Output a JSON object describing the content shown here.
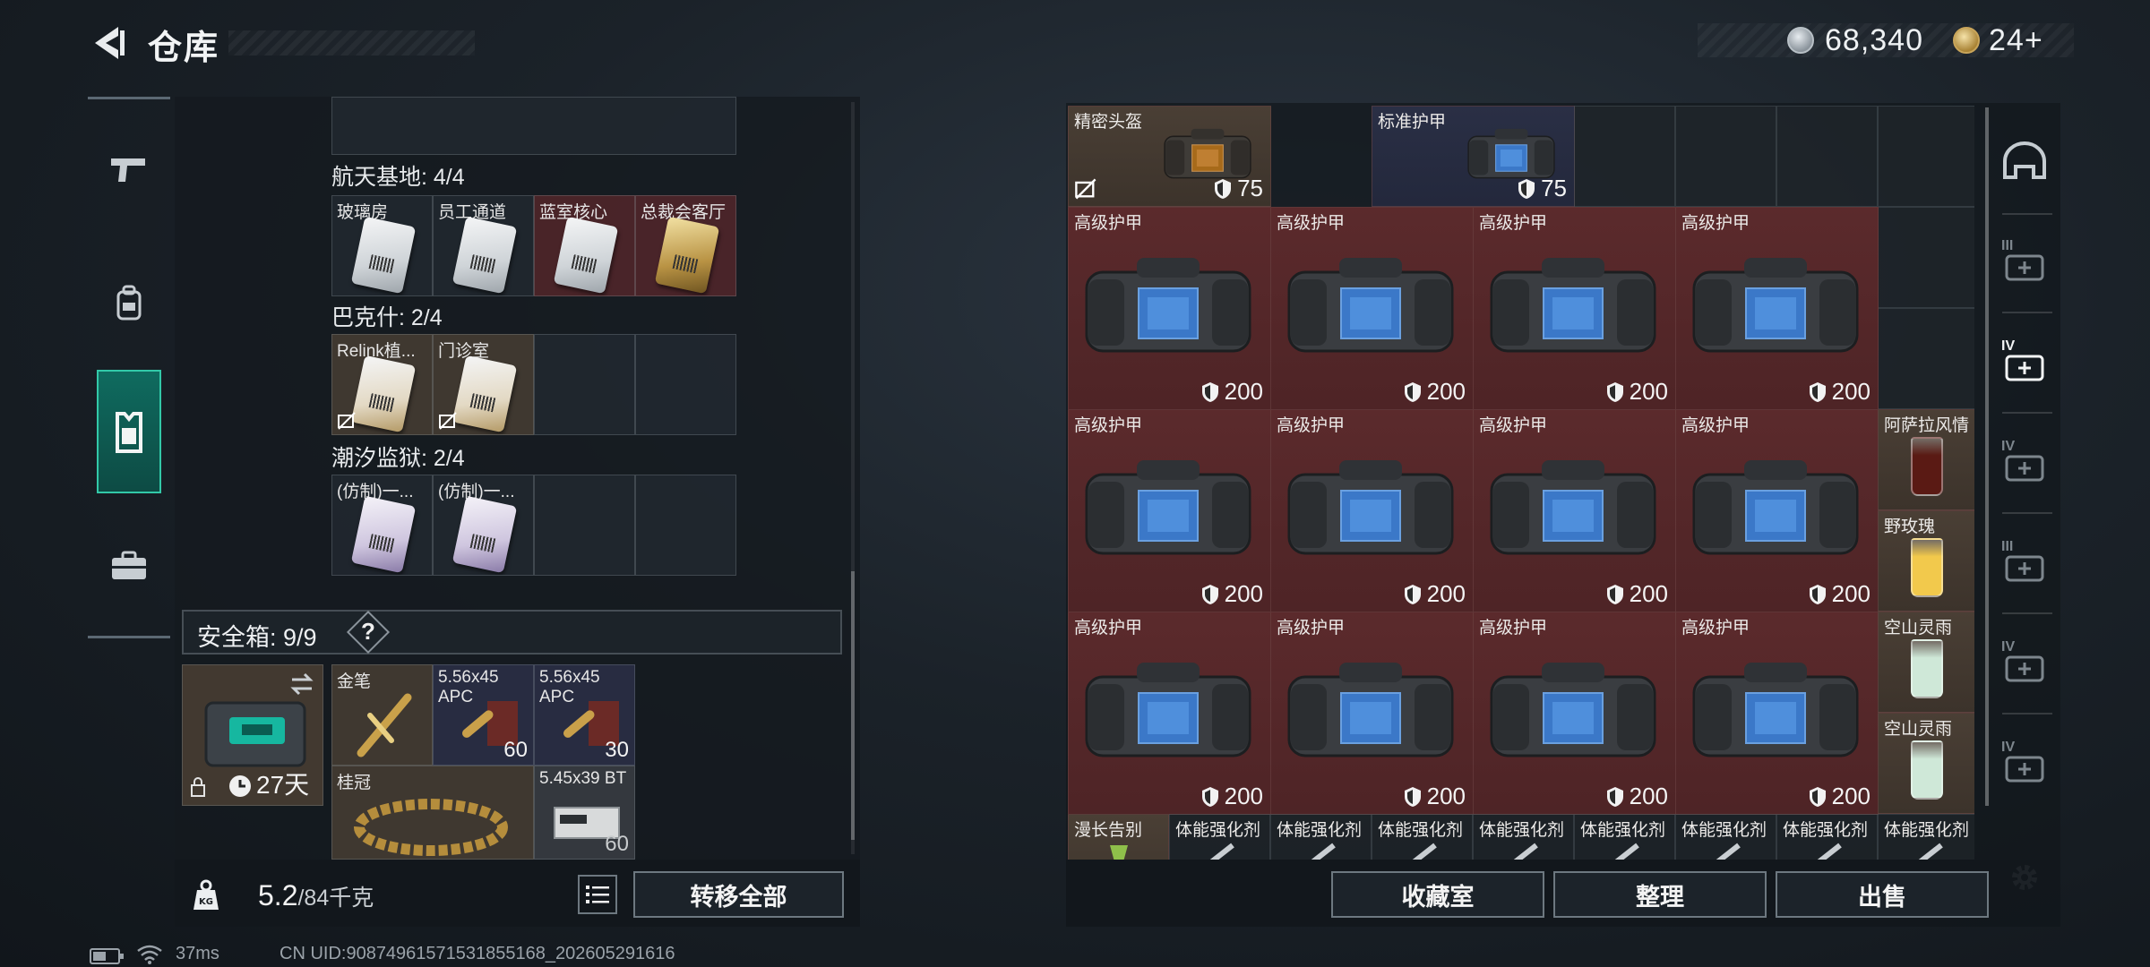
{
  "header": {
    "title": "仓库",
    "currencies": [
      {
        "icon": "silver-coin-icon",
        "value": "68,340"
      },
      {
        "icon": "gold-coin-icon",
        "value": "24+"
      }
    ]
  },
  "left_nav": {
    "items": [
      {
        "icon": "gun-icon",
        "active": false
      },
      {
        "icon": "backpack-icon",
        "active": false
      },
      {
        "icon": "vest-icon",
        "active": true
      },
      {
        "icon": "briefcase-icon",
        "active": false
      }
    ]
  },
  "keycards": {
    "groups": [
      {
        "label": "航天基地: 4/4",
        "items": [
          "玻璃房",
          "员工通道",
          "蓝室核心",
          "总裁会客厅"
        ]
      },
      {
        "label": "巴克什: 2/4",
        "items": [
          "Relink植...",
          "门诊室"
        ]
      },
      {
        "label": "潮汐监狱: 2/4",
        "items": [
          "(仿制)一...",
          "(仿制)一..."
        ]
      }
    ]
  },
  "safebox": {
    "label": "安全箱:",
    "count": "9/9",
    "help": "?",
    "duration": "27天",
    "items": [
      {
        "label": "金笔",
        "count": ""
      },
      {
        "label": "5.56x45 APC",
        "count": "60"
      },
      {
        "label": "5.56x45 APC",
        "count": "30"
      },
      {
        "label": "桂冠",
        "count": ""
      },
      {
        "label": "5.45x39 BT",
        "count": "60"
      }
    ]
  },
  "weight": {
    "current": "5.2",
    "capacity": "/84千克"
  },
  "left_actions": {
    "transfer_all": "转移全部"
  },
  "storage": {
    "top_row": [
      {
        "label": "精密头盔",
        "value": "75"
      },
      {
        "label": "标准护甲",
        "value": "75"
      }
    ],
    "armor_label": "高级护甲",
    "armor_value": "200",
    "side_items": [
      "阿萨拉风情",
      "野玫瑰",
      "空山灵雨",
      "空山灵雨"
    ],
    "bottom_row": [
      "漫长告别",
      "体能强化剂",
      "体能强化剂",
      "体能强化剂",
      "体能强化剂",
      "体能强化剂",
      "体能强化剂",
      "体能强化剂",
      "体能强化剂"
    ]
  },
  "right_actions": {
    "collection": "收藏室",
    "organize": "整理",
    "sell": "出售"
  },
  "right_nav": [
    "III",
    "IV",
    "IV",
    "III",
    "IV",
    "IV"
  ],
  "status_bar": {
    "ping": "37ms",
    "uid": "CN UID:908749615715318551​68_202605291616"
  },
  "colors": {
    "accent": "#32c9a8",
    "red_cell": "#5b2a2c",
    "navy_cell": "#2a2f45"
  }
}
